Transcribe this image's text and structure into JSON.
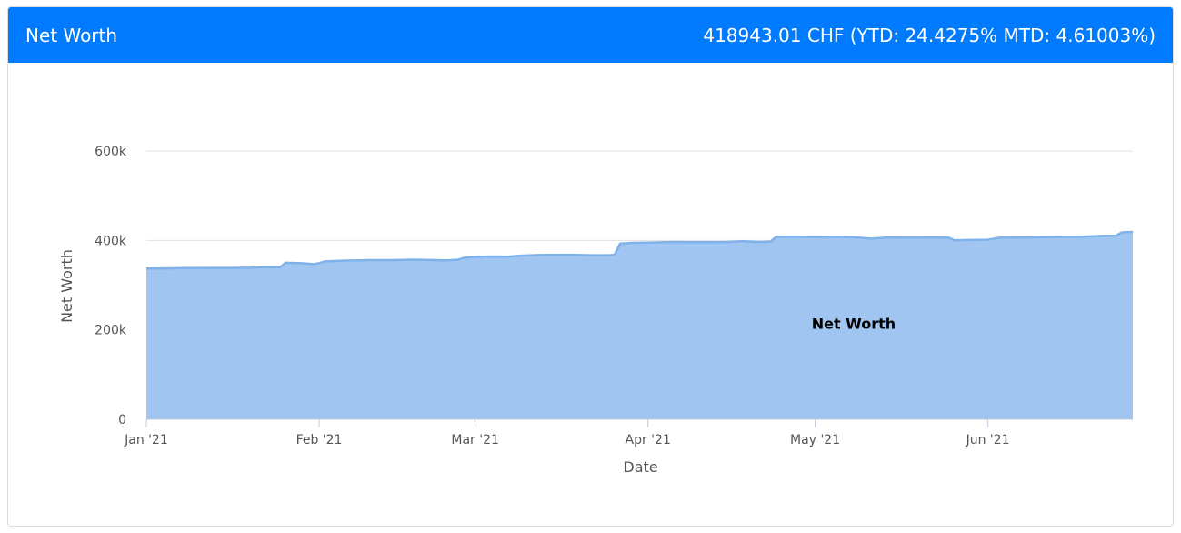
{
  "header": {
    "title": "Net Worth",
    "summary": "418943.01 CHF (YTD: 24.4275% MTD: 4.61003%)"
  },
  "colors": {
    "header_bg": "#007bff",
    "area_fill": "#9fc5f0",
    "area_line": "#7fb2ea",
    "grid": "#e0e0e0"
  },
  "chart_data": {
    "type": "area",
    "title": "",
    "xlabel": "Date",
    "ylabel": "Net Worth",
    "ylim": [
      0,
      600000
    ],
    "y_ticks": [
      {
        "value": 0,
        "label": "0"
      },
      {
        "value": 200000,
        "label": "200k"
      },
      {
        "value": 400000,
        "label": "400k"
      },
      {
        "value": 600000,
        "label": "600k"
      }
    ],
    "x_range": [
      "2021-01-01",
      "2021-06-27"
    ],
    "x_ticks": [
      {
        "date": "2021-01-01",
        "label": "Jan '21"
      },
      {
        "date": "2021-02-01",
        "label": "Feb '21"
      },
      {
        "date": "2021-03-01",
        "label": "Mar '21"
      },
      {
        "date": "2021-04-01",
        "label": "Apr '21"
      },
      {
        "date": "2021-05-01",
        "label": "May '21"
      },
      {
        "date": "2021-06-01",
        "label": "Jun '21"
      }
    ],
    "grid": true,
    "series": [
      {
        "name": "Net Worth",
        "points": [
          [
            "2021-01-01",
            337000
          ],
          [
            "2021-01-04",
            337500
          ],
          [
            "2021-01-08",
            338000
          ],
          [
            "2021-01-12",
            338500
          ],
          [
            "2021-01-16",
            338500
          ],
          [
            "2021-01-20",
            339000
          ],
          [
            "2021-01-22",
            340500
          ],
          [
            "2021-01-25",
            340000
          ],
          [
            "2021-01-26",
            350000
          ],
          [
            "2021-01-29",
            349000
          ],
          [
            "2021-01-31",
            347000
          ],
          [
            "2021-02-01",
            349000
          ],
          [
            "2021-02-02",
            353000
          ],
          [
            "2021-02-06",
            355000
          ],
          [
            "2021-02-10",
            356000
          ],
          [
            "2021-02-14",
            356000
          ],
          [
            "2021-02-18",
            357000
          ],
          [
            "2021-02-22",
            356000
          ],
          [
            "2021-02-24",
            355500
          ],
          [
            "2021-02-26",
            357000
          ],
          [
            "2021-02-27",
            361000
          ],
          [
            "2021-03-01",
            363000
          ],
          [
            "2021-03-04",
            364000
          ],
          [
            "2021-03-07",
            363500
          ],
          [
            "2021-03-09",
            366000
          ],
          [
            "2021-03-13",
            367500
          ],
          [
            "2021-03-18",
            368000
          ],
          [
            "2021-03-22",
            367000
          ],
          [
            "2021-03-25",
            367000
          ],
          [
            "2021-03-26",
            368000
          ],
          [
            "2021-03-27",
            393000
          ],
          [
            "2021-03-29",
            394500
          ],
          [
            "2021-04-01",
            395000
          ],
          [
            "2021-04-05",
            396500
          ],
          [
            "2021-04-10",
            396000
          ],
          [
            "2021-04-15",
            396500
          ],
          [
            "2021-04-18",
            398000
          ],
          [
            "2021-04-21",
            396500
          ],
          [
            "2021-04-23",
            397500
          ],
          [
            "2021-04-24",
            408000
          ],
          [
            "2021-04-27",
            408500
          ],
          [
            "2021-05-01",
            407500
          ],
          [
            "2021-05-05",
            408000
          ],
          [
            "2021-05-08",
            407000
          ],
          [
            "2021-05-11",
            404000
          ],
          [
            "2021-05-14",
            406500
          ],
          [
            "2021-05-18",
            406000
          ],
          [
            "2021-05-22",
            406500
          ],
          [
            "2021-05-25",
            406000
          ],
          [
            "2021-05-26",
            400000
          ],
          [
            "2021-05-29",
            401000
          ],
          [
            "2021-06-01",
            401500
          ],
          [
            "2021-06-03",
            406000
          ],
          [
            "2021-06-08",
            406500
          ],
          [
            "2021-06-13",
            407500
          ],
          [
            "2021-06-18",
            408500
          ],
          [
            "2021-06-22",
            410500
          ],
          [
            "2021-06-24",
            410500
          ],
          [
            "2021-06-25",
            418000
          ],
          [
            "2021-06-27",
            418943
          ]
        ]
      }
    ]
  }
}
